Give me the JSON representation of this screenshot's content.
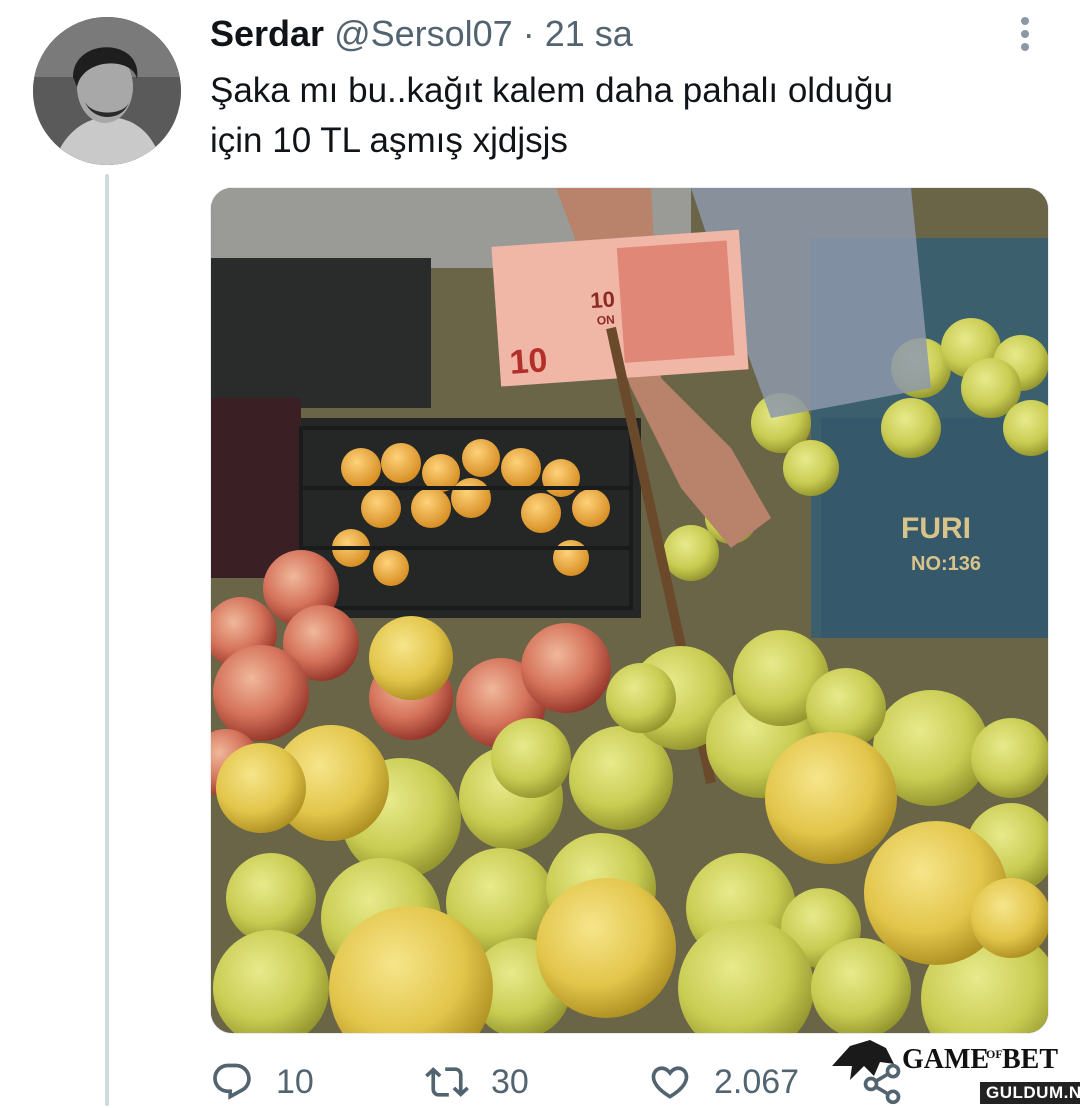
{
  "tweet": {
    "author_name": "Serdar",
    "author_handle": "@Sersol07",
    "separator": "·",
    "time": "21 sa",
    "text_line1": "Şaka mı bu..kağıt kalem daha pahalı olduğu",
    "text_line2": "için 10 TL aşmış xjdjsjs"
  },
  "media": {
    "description_icon": "photo-fruit-market",
    "banknote_value": "10",
    "banknote_word": "ON",
    "crate_text_1": "FURI",
    "crate_text_2": "NO:136"
  },
  "actions": {
    "replies": "10",
    "retweets": "30",
    "likes": "2.067"
  },
  "watermark": {
    "logo_text": "GAME",
    "logo_of": "OF",
    "logo_bet": "BET",
    "site": "GULDUM.NET"
  },
  "colors": {
    "text_primary": "#0f1419",
    "text_secondary": "#536471",
    "thread_line": "#cfd9de"
  }
}
